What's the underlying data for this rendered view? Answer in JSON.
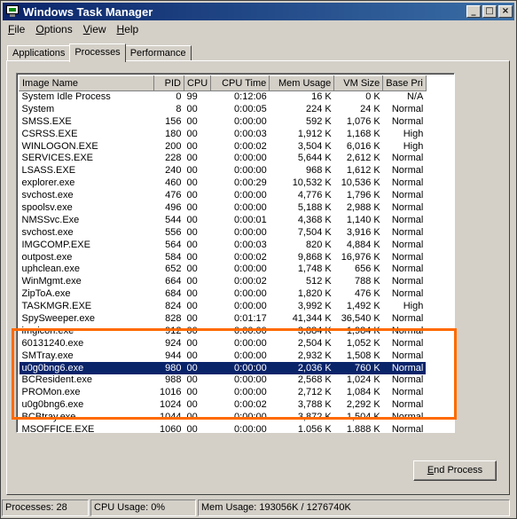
{
  "window": {
    "title": "Windows Task Manager"
  },
  "menu": [
    {
      "hot": "F",
      "rest": "ile"
    },
    {
      "hot": "O",
      "rest": "ptions"
    },
    {
      "hot": "V",
      "rest": "iew"
    },
    {
      "hot": "H",
      "rest": "elp"
    }
  ],
  "tabs": [
    "Applications",
    "Processes",
    "Performance"
  ],
  "active_tab": "Processes",
  "columns": [
    "Image Name",
    "PID",
    "CPU",
    "CPU Time",
    "Mem Usage",
    "VM Size",
    "Base Pri"
  ],
  "processes": [
    [
      "System Idle Process",
      "0",
      "99",
      "0:12:06",
      "16 K",
      "0 K",
      "N/A"
    ],
    [
      "System",
      "8",
      "00",
      "0:00:05",
      "224 K",
      "24 K",
      "Normal"
    ],
    [
      "SMSS.EXE",
      "156",
      "00",
      "0:00:00",
      "592 K",
      "1,076 K",
      "Normal"
    ],
    [
      "CSRSS.EXE",
      "180",
      "00",
      "0:00:03",
      "1,912 K",
      "1,168 K",
      "High"
    ],
    [
      "WINLOGON.EXE",
      "200",
      "00",
      "0:00:02",
      "3,504 K",
      "6,016 K",
      "High"
    ],
    [
      "SERVICES.EXE",
      "228",
      "00",
      "0:00:00",
      "5,644 K",
      "2,612 K",
      "Normal"
    ],
    [
      "LSASS.EXE",
      "240",
      "00",
      "0:00:00",
      "968 K",
      "1,612 K",
      "Normal"
    ],
    [
      "explorer.exe",
      "460",
      "00",
      "0:00:29",
      "10,532 K",
      "10,536 K",
      "Normal"
    ],
    [
      "svchost.exe",
      "476",
      "00",
      "0:00:00",
      "4,776 K",
      "1,796 K",
      "Normal"
    ],
    [
      "spoolsv.exe",
      "496",
      "00",
      "0:00:00",
      "5,188 K",
      "2,988 K",
      "Normal"
    ],
    [
      "NMSSvc.Exe",
      "544",
      "00",
      "0:00:01",
      "4,368 K",
      "1,140 K",
      "Normal"
    ],
    [
      "svchost.exe",
      "556",
      "00",
      "0:00:00",
      "7,504 K",
      "3,916 K",
      "Normal"
    ],
    [
      "IMGCOMP.EXE",
      "564",
      "00",
      "0:00:03",
      "820 K",
      "4,884 K",
      "Normal"
    ],
    [
      "outpost.exe",
      "584",
      "00",
      "0:00:02",
      "9,868 K",
      "16,976 K",
      "Normal"
    ],
    [
      "uphclean.exe",
      "652",
      "00",
      "0:00:00",
      "1,748 K",
      "656 K",
      "Normal"
    ],
    [
      "WinMgmt.exe",
      "664",
      "00",
      "0:00:02",
      "512 K",
      "788 K",
      "Normal"
    ],
    [
      "ZipToA.exe",
      "684",
      "00",
      "0:00:00",
      "1,820 K",
      "476 K",
      "Normal"
    ],
    [
      "TASKMGR.EXE",
      "824",
      "00",
      "0:00:00",
      "3,992 K",
      "1,492 K",
      "High"
    ],
    [
      "SpySweeper.exe",
      "828",
      "00",
      "0:01:17",
      "41,344 K",
      "36,540 K",
      "Normal"
    ],
    [
      "imgicon.exe",
      "912",
      "00",
      "0:00:00",
      "3,884 K",
      "1,984 K",
      "Normal"
    ],
    [
      "60131240.exe",
      "924",
      "00",
      "0:00:00",
      "2,504 K",
      "1,052 K",
      "Normal"
    ],
    [
      "SMTray.exe",
      "944",
      "00",
      "0:00:00",
      "2,932 K",
      "1,508 K",
      "Normal"
    ],
    [
      "u0g0bng6.exe",
      "980",
      "00",
      "0:00:00",
      "2,036 K",
      "760 K",
      "Normal"
    ],
    [
      "BCResident.exe",
      "988",
      "00",
      "0:00:00",
      "2,568 K",
      "1,024 K",
      "Normal"
    ],
    [
      "PROMon.exe",
      "1016",
      "00",
      "0:00:00",
      "2,712 K",
      "1,084 K",
      "Normal"
    ],
    [
      "u0g0bng6.exe",
      "1024",
      "00",
      "0:00:02",
      "3,788 K",
      "2,292 K",
      "Normal"
    ],
    [
      "BCBtray.exe",
      "1044",
      "00",
      "0:00:00",
      "3,872 K",
      "1,504 K",
      "Normal"
    ],
    [
      "MSOFFICE.EXE",
      "1060",
      "00",
      "0:00:00",
      "1,056 K",
      "1,888 K",
      "Normal"
    ]
  ],
  "selected_row": 22,
  "end_process": {
    "hot": "E",
    "rest": "nd Process"
  },
  "status": {
    "processes": "Processes: 28",
    "cpu": "CPU Usage: 0%",
    "mem": "Mem Usage: 193056K / 1276740K"
  },
  "colors": {
    "title_start": "#0a246a",
    "title_end": "#3a6ea5",
    "selection": "#0a246a",
    "annotation": "#ff6a00"
  }
}
